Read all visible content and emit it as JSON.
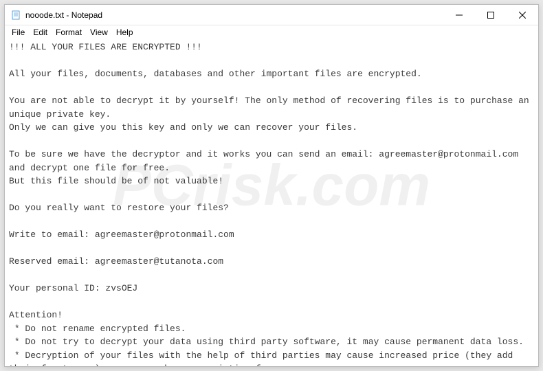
{
  "titlebar": {
    "title": "nooode.txt - Notepad"
  },
  "menubar": {
    "items": [
      "File",
      "Edit",
      "Format",
      "View",
      "Help"
    ]
  },
  "content": {
    "lines": [
      "!!! ALL YOUR FILES ARE ENCRYPTED !!!",
      "",
      "All your files, documents, databases and other important files are encrypted.",
      "",
      "You are not able to decrypt it by yourself! The only method of recovering files is to purchase an unique private key.",
      "Only we can give you this key and only we can recover your files.",
      "",
      "To be sure we have the decryptor and it works you can send an email: agreemaster@protonmail.com  and decrypt one file for free.",
      "But this file should be of not valuable!",
      "",
      "Do you really want to restore your files?",
      "",
      "Write to email: agreemaster@protonmail.com",
      "",
      "Reserved email: agreemaster@tutanota.com",
      "",
      "Your personal ID: zvsOEJ",
      "",
      "Attention!",
      " * Do not rename encrypted files.",
      " * Do not try to decrypt your data using third party software, it may cause permanent data loss.",
      " * Decryption of your files with the help of third parties may cause increased price (they add their fee to our) or you can become a victim of a scam."
    ]
  },
  "watermark": "PCrisk.com"
}
